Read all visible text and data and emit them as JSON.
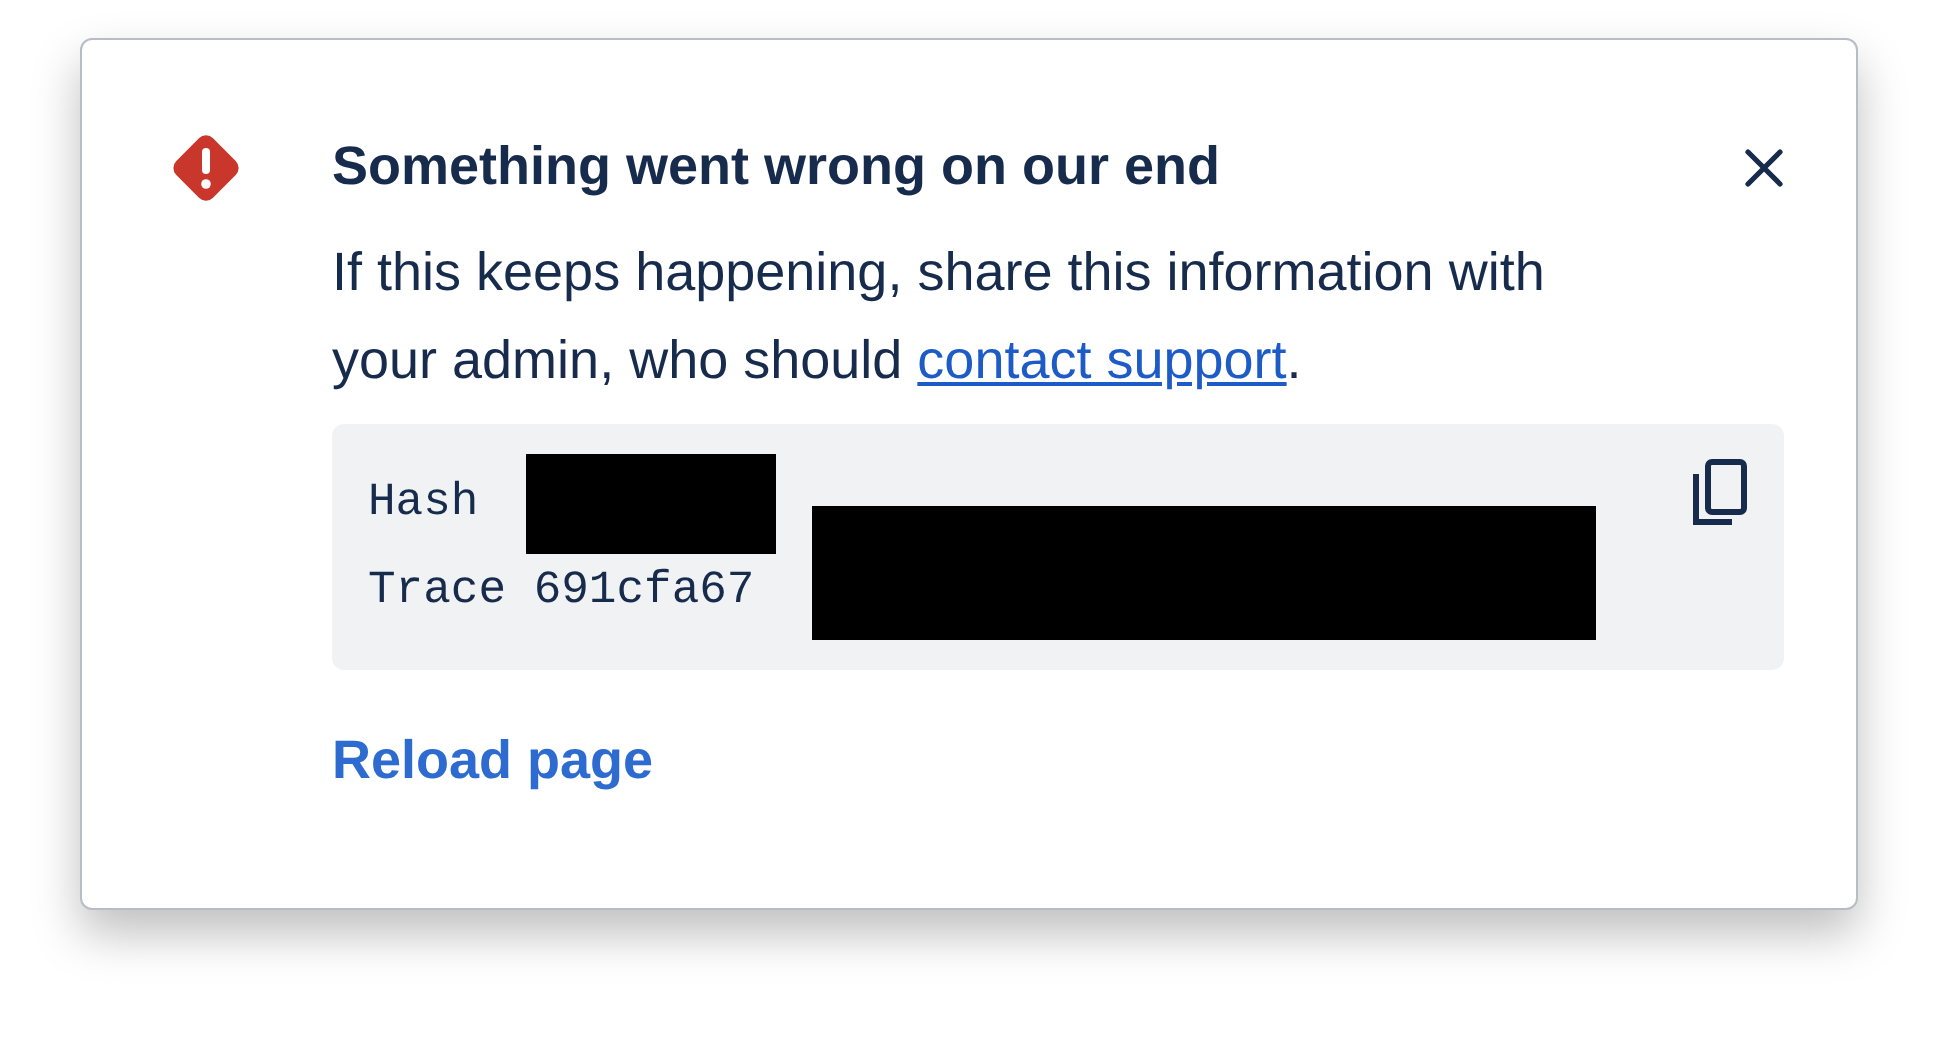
{
  "dialog": {
    "title": "Something went wrong on our end",
    "message": {
      "before": "If this keeps happening, share this information with your admin, who should ",
      "link": "contact support",
      "after": "."
    },
    "details": [
      {
        "label": "Hash"
      },
      {
        "label": "Trace",
        "value": "691cfa67"
      }
    ],
    "action": "Reload page"
  }
}
